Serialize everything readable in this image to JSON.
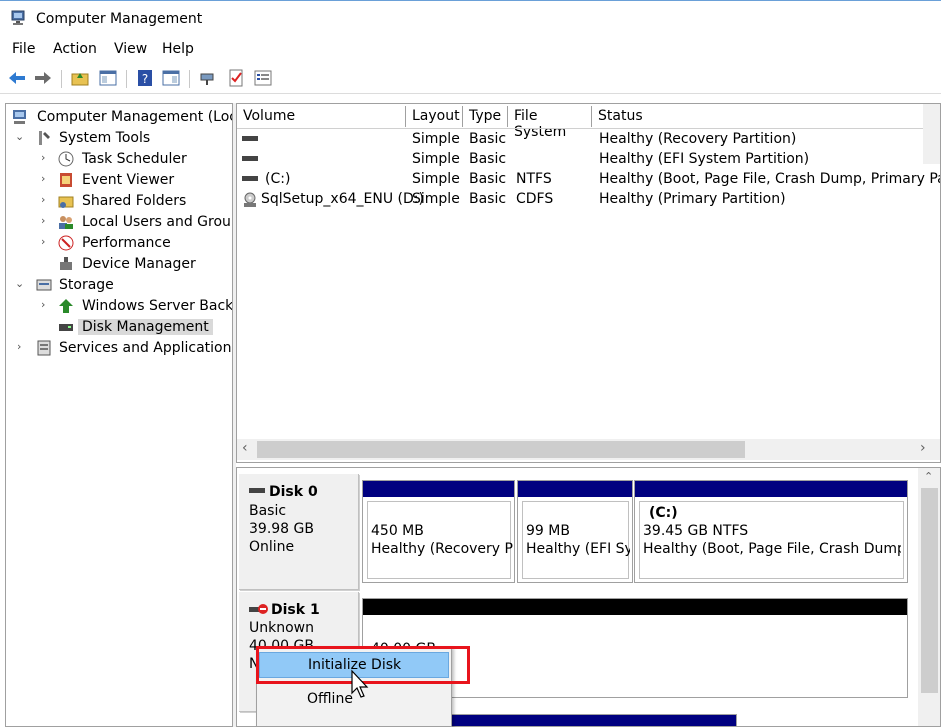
{
  "window": {
    "title": "Computer Management"
  },
  "menu": [
    "File",
    "Action",
    "View",
    "Help"
  ],
  "toolbar_icons": [
    "back-arrow-icon",
    "forward-arrow-icon",
    "up-folder-icon",
    "show-hide-tree-icon",
    "help-icon",
    "properties-pane-icon",
    "connect-icon",
    "checklist-icon",
    "list-icon"
  ],
  "tree": {
    "root": "Computer Management (Local",
    "system_tools": "System Tools",
    "task_scheduler": "Task Scheduler",
    "event_viewer": "Event Viewer",
    "shared_folders": "Shared Folders",
    "local_users": "Local Users and Groups",
    "performance": "Performance",
    "device_manager": "Device Manager",
    "storage": "Storage",
    "wsb": "Windows Server Backup",
    "disk_mgmt": "Disk Management",
    "services": "Services and Applications"
  },
  "volumes": {
    "headers": [
      "Volume",
      "Layout",
      "Type",
      "File System",
      "Status"
    ],
    "rows": [
      {
        "volume": "",
        "layout": "Simple",
        "type": "Basic",
        "fs": "",
        "status": "Healthy (Recovery Partition)"
      },
      {
        "volume": "",
        "layout": "Simple",
        "type": "Basic",
        "fs": "",
        "status": "Healthy (EFI System Partition)"
      },
      {
        "volume": "(C:)",
        "layout": "Simple",
        "type": "Basic",
        "fs": "NTFS",
        "status": "Healthy (Boot, Page File, Crash Dump, Primary Partiti"
      },
      {
        "volume": "SqlSetup_x64_ENU (D:)",
        "layout": "Simple",
        "type": "Basic",
        "fs": "CDFS",
        "status": "Healthy (Primary Partition)"
      }
    ]
  },
  "disks": {
    "disk0": {
      "name": "Disk 0",
      "kind": "Basic",
      "size": "39.98 GB",
      "state": "Online",
      "partitions": [
        {
          "title": "",
          "size": "450 MB",
          "status": "Healthy (Recovery Par"
        },
        {
          "title": "",
          "size": "99 MB",
          "status": "Healthy (EFI Sys"
        },
        {
          "title": "(C:)",
          "size": "39.45 GB NTFS",
          "status": "Healthy (Boot, Page File, Crash Dump, Pr"
        }
      ]
    },
    "disk1": {
      "name": "Disk 1",
      "kind": "Unknown",
      "size": "40.00 GB",
      "state": "No",
      "part_size": "40.00 GB"
    }
  },
  "context_menu": {
    "initialize": "Initialize Disk",
    "offline": "Offline"
  },
  "colors": {
    "partition_bar": "#000080",
    "unallocated_bar": "#000000",
    "highlight": "#e8141c",
    "menu_hover": "#91c9f7"
  }
}
